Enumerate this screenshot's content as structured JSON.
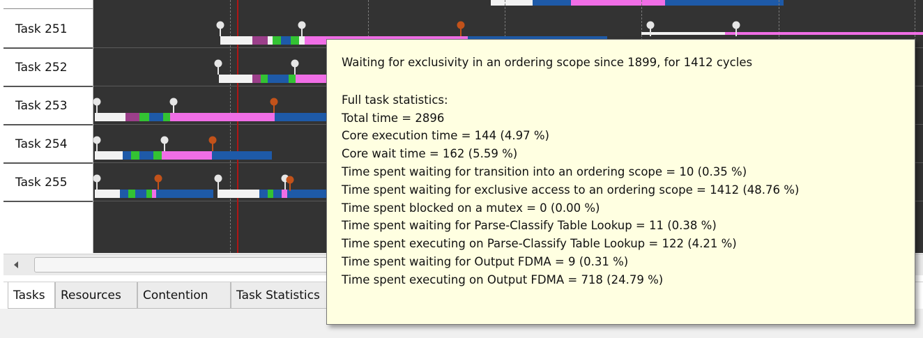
{
  "tasks": [
    {
      "label": "Task 251"
    },
    {
      "label": "Task 252"
    },
    {
      "label": "Task 253"
    },
    {
      "label": "Task 254"
    },
    {
      "label": "Task 255"
    }
  ],
  "colors": {
    "background": "#333333",
    "idle": "#f2f2f2",
    "magenta": "#9b3f8a",
    "green": "#33c233",
    "blue": "#1e5aa8",
    "pink": "#f06ee6",
    "marker_white": "#e6e6e6",
    "marker_orange": "#c2521a",
    "cursor": "#b01515",
    "tooltip_bg": "#ffffe1"
  },
  "tabs": [
    {
      "label": "Tasks",
      "active": true
    },
    {
      "label": "Resources",
      "active": false
    },
    {
      "label": "Contention",
      "active": false
    },
    {
      "label": "Task Statistics",
      "active": false
    }
  ],
  "scroll": {
    "left_icon": "arrow-left-icon"
  },
  "tooltip": {
    "header": "Waiting for exclusivity in an ordering scope since 1899, for 1412 cycles",
    "stats_title": "Full task statistics:",
    "lines": [
      "Total time = 2896",
      "Core execution time = 144 (4.97 %)",
      "Core wait time = 162 (5.59 %)",
      "Time spent waiting for transition into an ordering scope = 10 (0.35 %)",
      "Time spent waiting for exclusive access to an ordering scope = 1412 (48.76 %)",
      "Time spent blocked on a mutex = 0 (0.00 %)",
      "Time spent waiting for Parse-Classify Table Lookup = 11 (0.38 %)",
      "Time spent executing on Parse-Classify Table Lookup = 122 (4.21 %)",
      "Time spent waiting for Output FDMA = 9 (0.31 %)",
      "Time spent executing on Output FDMA = 718 (24.79 %)"
    ]
  }
}
